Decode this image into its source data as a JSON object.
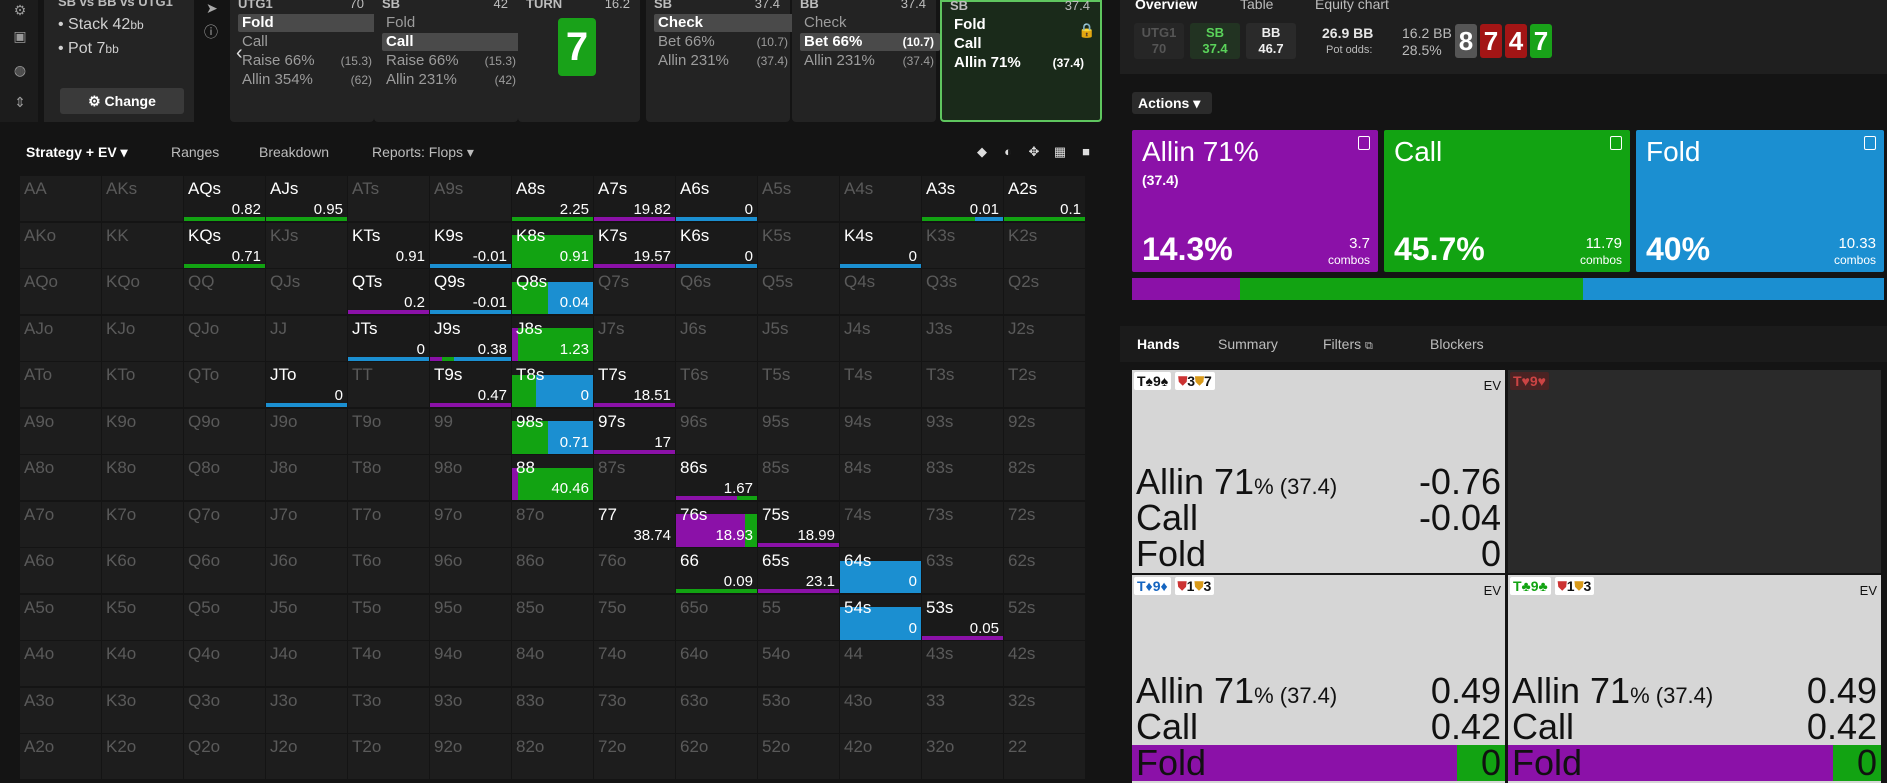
{
  "rail": {
    "icons": [
      "gear-icon",
      "save-icon",
      "gamepad-icon",
      "expand-icon"
    ]
  },
  "info": {
    "title": "SB vs BB vs UTG1",
    "stack_label": "Stack 42",
    "stack_unit": "bb",
    "pot_label": "Pot 7",
    "pot_unit": "bb",
    "change_label": "Change"
  },
  "columns": [
    {
      "pos": "UTG1",
      "stack": "70",
      "options": [
        {
          "label": "Fold",
          "n": "",
          "sel": true
        },
        {
          "label": "Call",
          "n": "",
          "sel": false
        },
        {
          "label": "Raise 66%",
          "n": "(15.3)",
          "sel": false
        },
        {
          "label": "Allin 354%",
          "n": "(62)",
          "sel": false
        }
      ]
    },
    {
      "pos": "SB",
      "stack": "42",
      "options": [
        {
          "label": "Fold",
          "n": "",
          "sel": false
        },
        {
          "label": "Call",
          "n": "",
          "sel": true
        },
        {
          "label": "Raise 66%",
          "n": "(15.3)",
          "sel": false
        },
        {
          "label": "Allin 231%",
          "n": "(42)",
          "sel": false
        }
      ]
    },
    {
      "pos": "TURN",
      "stack": "16.2",
      "card": "7"
    },
    {
      "pos": "SB",
      "stack": "37.4",
      "options": [
        {
          "label": "Check",
          "n": "",
          "sel": true
        },
        {
          "label": "Bet 66%",
          "n": "(10.7)",
          "sel": false
        },
        {
          "label": "Allin 231%",
          "n": "(37.4)",
          "sel": false
        }
      ]
    },
    {
      "pos": "BB",
      "stack": "37.4",
      "options": [
        {
          "label": "Check",
          "n": "",
          "sel": false
        },
        {
          "label": "Bet 66%",
          "n": "(10.7)",
          "sel": true
        },
        {
          "label": "Allin 231%",
          "n": "(37.4)",
          "sel": false
        }
      ]
    },
    {
      "pos": "SB",
      "stack": "37.4",
      "options": [
        {
          "label": "Fold",
          "n": "",
          "sel": false
        },
        {
          "label": "Call",
          "n": "",
          "sel": false
        },
        {
          "label": "Allin 71%",
          "n": "(37.4)",
          "sel": false
        }
      ]
    }
  ],
  "toolbar": {
    "strategy": "Strategy + EV",
    "ranges": "Ranges",
    "breakdown": "Breakdown",
    "reports": "Reports: Flops"
  },
  "colors": {
    "allin": "#8b11a8",
    "call": "#12a312",
    "fold": "#1b8fd1"
  },
  "grid": [
    [
      "AA",
      "AKs",
      "AQs",
      "AJs",
      "ATs",
      "A9s",
      "A8s",
      "A7s",
      "A6s",
      "A5s",
      "A4s",
      "A3s",
      "A2s"
    ],
    [
      "AKo",
      "KK",
      "KQs",
      "KJs",
      "KTs",
      "K9s",
      "K8s",
      "K7s",
      "K6s",
      "K5s",
      "K4s",
      "K3s",
      "K2s"
    ],
    [
      "AQo",
      "KQo",
      "QQ",
      "QJs",
      "QTs",
      "Q9s",
      "Q8s",
      "Q7s",
      "Q6s",
      "Q5s",
      "Q4s",
      "Q3s",
      "Q2s"
    ],
    [
      "AJo",
      "KJo",
      "QJo",
      "JJ",
      "JTs",
      "J9s",
      "J8s",
      "J7s",
      "J6s",
      "J5s",
      "J4s",
      "J3s",
      "J2s"
    ],
    [
      "ATo",
      "KTo",
      "QTo",
      "JTo",
      "TT",
      "T9s",
      "T8s",
      "T7s",
      "T6s",
      "T5s",
      "T4s",
      "T3s",
      "T2s"
    ],
    [
      "A9o",
      "K9o",
      "Q9o",
      "J9o",
      "T9o",
      "99",
      "98s",
      "97s",
      "96s",
      "95s",
      "94s",
      "93s",
      "92s"
    ],
    [
      "A8o",
      "K8o",
      "Q8o",
      "J8o",
      "T8o",
      "98o",
      "88",
      "87s",
      "86s",
      "85s",
      "84s",
      "83s",
      "82s"
    ],
    [
      "A7o",
      "K7o",
      "Q7o",
      "J7o",
      "T7o",
      "97o",
      "87o",
      "77",
      "76s",
      "75s",
      "74s",
      "73s",
      "72s"
    ],
    [
      "A6o",
      "K6o",
      "Q6o",
      "J6o",
      "T6o",
      "96o",
      "86o",
      "76o",
      "66",
      "65s",
      "64s",
      "63s",
      "62s"
    ],
    [
      "A5o",
      "K5o",
      "Q5o",
      "J5o",
      "T5o",
      "95o",
      "85o",
      "75o",
      "65o",
      "55",
      "54s",
      "53s",
      "52s"
    ],
    [
      "A4o",
      "K4o",
      "Q4o",
      "J4o",
      "T4o",
      "94o",
      "84o",
      "74o",
      "64o",
      "54o",
      "44",
      "43s",
      "42s"
    ],
    [
      "A3o",
      "K3o",
      "Q3o",
      "J3o",
      "T3o",
      "93o",
      "83o",
      "73o",
      "63o",
      "53o",
      "43o",
      "33",
      "32s"
    ],
    [
      "A2o",
      "K2o",
      "Q2o",
      "J2o",
      "T2o",
      "92o",
      "82o",
      "72o",
      "62o",
      "52o",
      "42o",
      "32o",
      "22"
    ]
  ],
  "active_cells": {
    "AQs": {
      "ev": "0.82",
      "mix": [
        0,
        1,
        0
      ],
      "full": false
    },
    "AJs": {
      "ev": "0.95",
      "mix": [
        0,
        1,
        0
      ],
      "full": false
    },
    "A8s": {
      "ev": "2.25",
      "mix": [
        0,
        1,
        0
      ],
      "full": false
    },
    "A7s": {
      "ev": "19.82",
      "mix": [
        1,
        0,
        0
      ],
      "full": false
    },
    "A6s": {
      "ev": "0",
      "mix": [
        0,
        0,
        1
      ],
      "full": false
    },
    "A3s": {
      "ev": "0.01",
      "mix": [
        0,
        0.65,
        0.35
      ],
      "full": false
    },
    "A2s": {
      "ev": "0.1",
      "mix": [
        0,
        1,
        0
      ],
      "full": false
    },
    "KQs": {
      "ev": "0.71",
      "mix": [
        0,
        1,
        0
      ],
      "full": false
    },
    "KTs": {
      "ev": "0.91",
      "mix": [
        0,
        0,
        0
      ],
      "full": false
    },
    "K9s": {
      "ev": "-0.01",
      "mix": [
        0,
        0,
        1
      ],
      "full": false
    },
    "K8s": {
      "ev": "0.91",
      "mix": [
        0,
        1,
        0
      ],
      "full": true
    },
    "K7s": {
      "ev": "19.57",
      "mix": [
        1,
        0,
        0
      ],
      "full": false
    },
    "K6s": {
      "ev": "0",
      "mix": [
        0,
        0,
        1
      ],
      "full": false
    },
    "K4s": {
      "ev": "0",
      "mix": [
        0,
        0,
        1
      ],
      "full": false
    },
    "QTs": {
      "ev": "0.2",
      "mix": [
        1,
        0,
        0
      ],
      "full": false
    },
    "Q9s": {
      "ev": "-0.01",
      "mix": [
        0,
        0,
        1
      ],
      "full": false
    },
    "Q8s": {
      "ev": "0.04",
      "mix": [
        0,
        0.45,
        0.55
      ],
      "full": true
    },
    "JTs": {
      "ev": "0",
      "mix": [
        0,
        0,
        1
      ],
      "full": false
    },
    "J9s": {
      "ev": "0.38",
      "mix": [
        0.15,
        0.15,
        0.7
      ],
      "full": false
    },
    "J8s": {
      "ev": "1.23",
      "mix": [
        0.08,
        0.92,
        0
      ],
      "full": true
    },
    "JTo": {
      "ev": "0",
      "mix": [
        0,
        0,
        1
      ],
      "full": false
    },
    "T9s": {
      "ev": "0.47",
      "mix": [
        1,
        0,
        0
      ],
      "full": false
    },
    "T8s": {
      "ev": "0",
      "mix": [
        0,
        0.3,
        0.7
      ],
      "full": true
    },
    "T7s": {
      "ev": "18.51",
      "mix": [
        1,
        0,
        0
      ],
      "full": false
    },
    "98s": {
      "ev": "0.71",
      "mix": [
        0,
        0.45,
        0.55
      ],
      "full": true
    },
    "97s": {
      "ev": "17",
      "mix": [
        1,
        0,
        0
      ],
      "full": false
    },
    "88": {
      "ev": "40.46",
      "mix": [
        0.08,
        0.92,
        0
      ],
      "full": true
    },
    "86s": {
      "ev": "1.67",
      "mix": [
        0.75,
        0.25,
        0
      ],
      "full": false
    },
    "77": {
      "ev": "38.74",
      "mix": [
        0,
        0,
        0
      ],
      "full": false
    },
    "76s": {
      "ev": "18.93",
      "mix": [
        0.85,
        0.15,
        0
      ],
      "full": true
    },
    "75s": {
      "ev": "18.99",
      "mix": [
        1,
        0,
        0
      ],
      "full": false
    },
    "66": {
      "ev": "0.09",
      "mix": [
        0,
        1,
        0
      ],
      "full": false
    },
    "65s": {
      "ev": "23.1",
      "mix": [
        1,
        0,
        0
      ],
      "full": false
    },
    "64s": {
      "ev": "0",
      "mix": [
        0,
        0,
        1
      ],
      "full": true
    },
    "54s": {
      "ev": "0",
      "mix": [
        0,
        0,
        1
      ],
      "full": true
    },
    "53s": {
      "ev": "0.05",
      "mix": [
        1,
        0,
        0
      ],
      "full": false
    }
  },
  "right": {
    "tabs": [
      "Overview",
      "Table",
      "Equity chart"
    ],
    "positions": [
      {
        "pos": "UTG1",
        "stack": "70"
      },
      {
        "pos": "SB",
        "stack": "37.4"
      },
      {
        "pos": "BB",
        "stack": "46.7"
      }
    ],
    "pot_bb": "26.9 BB",
    "call_bb": "16.2 BB",
    "pot_odds_label": "Pot odds:",
    "pot_odds": "28.5%",
    "board": [
      {
        "r": "8",
        "c": "#555"
      },
      {
        "r": "7",
        "c": "#a31515"
      },
      {
        "r": "4",
        "c": "#a31515"
      },
      {
        "r": "7",
        "c": "#19a219"
      }
    ],
    "actions_label": "Actions",
    "actions": [
      {
        "name": "Allin 71%",
        "sub": "(37.4)",
        "pct": "14.3%",
        "combos": "3.7",
        "combos_label": "combos"
      },
      {
        "name": "Call",
        "sub": "",
        "pct": "45.7%",
        "combos": "11.79",
        "combos_label": "combos"
      },
      {
        "name": "Fold",
        "sub": "",
        "pct": "40%",
        "combos": "10.33",
        "combos_label": "combos"
      }
    ],
    "dist": [
      14.3,
      45.7,
      40
    ],
    "hands_tabs": [
      "Hands",
      "Summary",
      "Filters",
      "Blockers"
    ],
    "hands": [
      {
        "combo": "T♠9♠",
        "combo_color": "#111",
        "chips": [
          "3",
          "7"
        ],
        "ev_label": "EV",
        "rows": [
          {
            "nm": "Allin 71",
            "pct": "% (37.4)",
            "v": "-0.76"
          },
          {
            "nm": "Call",
            "pct": "",
            "v": "-0.04"
          },
          {
            "nm": "Fold",
            "pct": "",
            "v": "0"
          }
        ],
        "mix": [
          0,
          0,
          0
        ]
      },
      {
        "combo": "T♥9♥",
        "combo_color": "#c44",
        "chips": [],
        "ev_label": "",
        "rows": [],
        "mix": [
          0,
          0,
          0
        ]
      },
      {
        "combo": "T♦9♦",
        "combo_color": "#1565c0",
        "chips": [
          "1",
          "3"
        ],
        "ev_label": "EV",
        "rows": [
          {
            "nm": "Allin 71",
            "pct": "% (37.4)",
            "v": "0.49"
          },
          {
            "nm": "Call",
            "pct": "",
            "v": "0.42"
          },
          {
            "nm": "Fold",
            "pct": "",
            "v": "0"
          }
        ],
        "mix": [
          0.87,
          0.13,
          0
        ]
      },
      {
        "combo": "T♣9♣",
        "combo_color": "#12a312",
        "chips": [
          "1",
          "3"
        ],
        "ev_label": "EV",
        "rows": [
          {
            "nm": "Allin 71",
            "pct": "% (37.4)",
            "v": "0.49"
          },
          {
            "nm": "Call",
            "pct": "",
            "v": "0.42"
          },
          {
            "nm": "Fold",
            "pct": "",
            "v": "0"
          }
        ],
        "mix": [
          0.87,
          0.13,
          0
        ]
      }
    ]
  }
}
